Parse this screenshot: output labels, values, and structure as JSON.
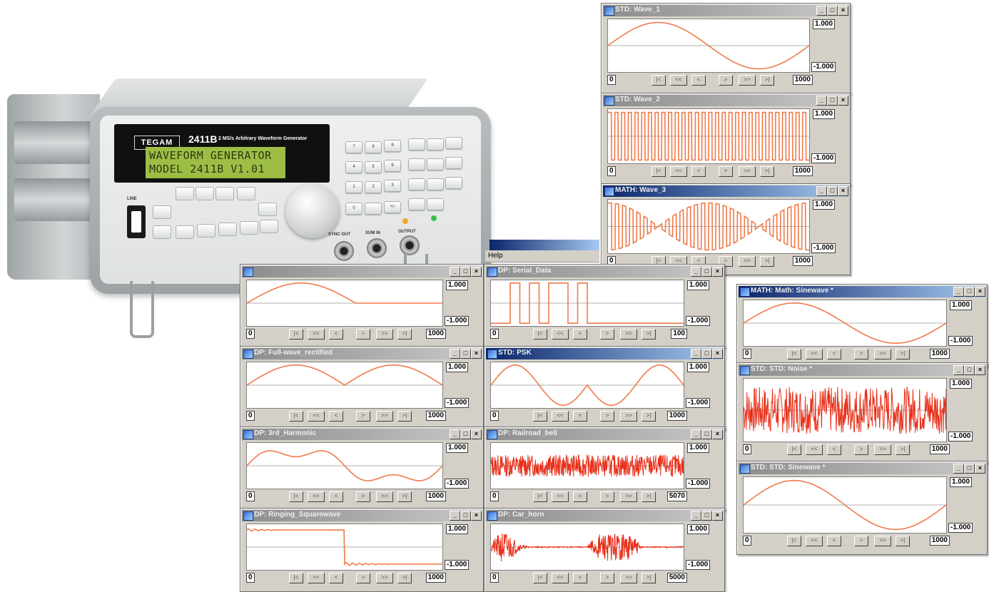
{
  "instrument": {
    "brand": "TEGAM",
    "model": "2411B",
    "description": "2 MS/s Arbitrary Waveform Generator",
    "lcd_line1": "WAVEFORM GENERATOR",
    "lcd_line2": "MODEL 2411B  V1.01",
    "labels": {
      "line": "LINE",
      "sync_out": "SYNC OUT",
      "sum_in": "SUM IN",
      "output": "OUTPUT"
    },
    "keypad": [
      "7",
      "8",
      "9",
      "4",
      "5",
      "6",
      "1",
      "2",
      "3",
      "0",
      ".",
      "+/-"
    ]
  },
  "menu": {
    "help": "Help"
  },
  "nav_buttons": [
    "|<",
    "<<",
    "<",
    ">",
    ">>",
    ">|"
  ],
  "windows": [
    {
      "id": "w1",
      "title": "STD: Wave_1",
      "active": false,
      "ymax": "1.000",
      "ymin": "-1.000",
      "xmin": "0",
      "xmax": "1000",
      "wave": "sine1"
    },
    {
      "id": "w2",
      "title": "STD: Wave_2",
      "active": false,
      "ymax": "1.000",
      "ymin": "-1.000",
      "xmin": "0",
      "xmax": "1000",
      "wave": "square_fast"
    },
    {
      "id": "w3",
      "title": "MATH: Wave_3",
      "active": true,
      "ymax": "1.000",
      "ymin": "-1.000",
      "xmin": "0",
      "xmax": "1000",
      "wave": "am_square"
    },
    {
      "id": "w4",
      "title": "",
      "active": false,
      "ymax": "1.000",
      "ymin": "-1.000",
      "xmin": "0",
      "xmax": "1000",
      "wave": "halfwave"
    },
    {
      "id": "w5",
      "title": "DP: Serial_Data",
      "active": false,
      "ymax": "1.000",
      "ymin": "-1.000",
      "xmin": "0",
      "xmax": "100",
      "wave": "serial"
    },
    {
      "id": "w6",
      "title": "DP: Full-wave_rectified",
      "active": false,
      "ymax": "1.000",
      "ymin": "-1.000",
      "xmin": "0",
      "xmax": "1000",
      "wave": "fullwave"
    },
    {
      "id": "w7",
      "title": "STD: PSK",
      "active": true,
      "ymax": "1.000",
      "ymin": "-1.000",
      "xmin": "0",
      "xmax": "1000",
      "wave": "psk"
    },
    {
      "id": "w8",
      "title": "DP: 3rd_Harmonic",
      "active": false,
      "ymax": "1.000",
      "ymin": "-1.000",
      "xmin": "0",
      "xmax": "1000",
      "wave": "harmonic"
    },
    {
      "id": "w9",
      "title": "DP: Railroad_bell",
      "active": false,
      "ymax": "1.000",
      "ymin": "-1.000",
      "xmin": "0",
      "xmax": "5070",
      "wave": "noise_dense"
    },
    {
      "id": "w10",
      "title": "DP: Ringing_Squarewave",
      "active": false,
      "ymax": "1.000",
      "ymin": "-1.000",
      "xmin": "0",
      "xmax": "1000",
      "wave": "ringing"
    },
    {
      "id": "w11",
      "title": "DP: Car_horn",
      "active": false,
      "ymax": "1.000",
      "ymin": "-1.000",
      "xmin": "0",
      "xmax": "5000",
      "wave": "carhorn"
    },
    {
      "id": "w12",
      "title": "MATH: Math: Sinewave *",
      "active": true,
      "ymax": "1.000",
      "ymin": "-1.000",
      "xmin": "0",
      "xmax": "1000",
      "wave": "sine1"
    },
    {
      "id": "w13",
      "title": "STD: STD: Noise *",
      "active": false,
      "ymax": "1.000",
      "ymin": "-1.000",
      "xmin": "0",
      "xmax": "1000",
      "wave": "noise"
    },
    {
      "id": "w14",
      "title": "STD: STD: Sinewave *",
      "active": false,
      "ymax": "1.000",
      "ymin": "-1.000",
      "xmin": "0",
      "xmax": "1000",
      "wave": "sine1"
    }
  ],
  "colors": {
    "trace": "#f07a4a",
    "trace_dense": "#e8301a",
    "active_title": "#0a246a"
  }
}
